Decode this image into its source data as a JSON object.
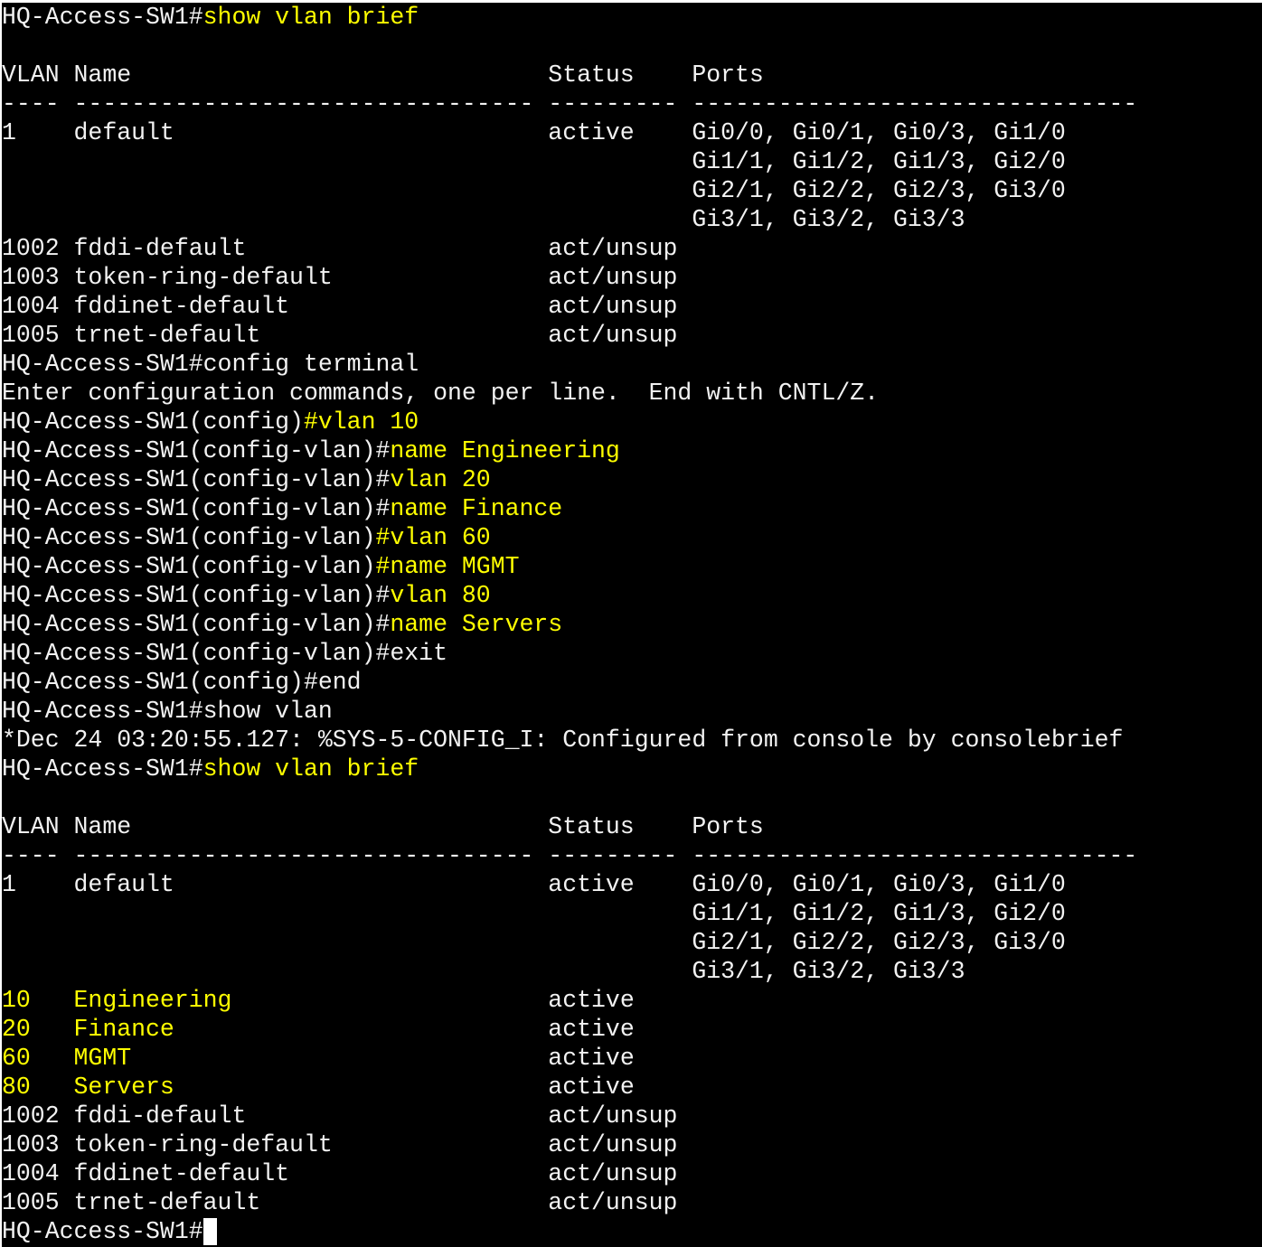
{
  "colors": {
    "background": "#000000",
    "text": "#f2f2f2",
    "highlight": "#ffff00",
    "cursor": "#ffffff"
  },
  "terminal": {
    "lines": [
      [
        {
          "t": "HQ-Access-SW1#"
        },
        {
          "t": "show vlan brief",
          "hl": true
        }
      ],
      [
        {
          "t": ""
        }
      ],
      [
        {
          "t": "VLAN Name                             Status    Ports"
        }
      ],
      [
        {
          "t": "---- -------------------------------- --------- -------------------------------"
        }
      ],
      [
        {
          "t": "1    default                          active    Gi0/0, Gi0/1, Gi0/3, Gi1/0"
        }
      ],
      [
        {
          "t": "                                                Gi1/1, Gi1/2, Gi1/3, Gi2/0"
        }
      ],
      [
        {
          "t": "                                                Gi2/1, Gi2/2, Gi2/3, Gi3/0"
        }
      ],
      [
        {
          "t": "                                                Gi3/1, Gi3/2, Gi3/3"
        }
      ],
      [
        {
          "t": "1002 fddi-default                     act/unsup"
        }
      ],
      [
        {
          "t": "1003 token-ring-default               act/unsup"
        }
      ],
      [
        {
          "t": "1004 fddinet-default                  act/unsup"
        }
      ],
      [
        {
          "t": "1005 trnet-default                    act/unsup"
        }
      ],
      [
        {
          "t": "HQ-Access-SW1#config terminal"
        }
      ],
      [
        {
          "t": "Enter configuration commands, one per line.  End with CNTL/Z."
        }
      ],
      [
        {
          "t": "HQ-Access-SW1(config)"
        },
        {
          "t": "#vlan 10",
          "hl": true
        }
      ],
      [
        {
          "t": "HQ-Access-SW1(config-vlan)#"
        },
        {
          "t": "name Engineering",
          "hl": true
        }
      ],
      [
        {
          "t": "HQ-Access-SW1(config-vlan)#"
        },
        {
          "t": "vlan 20",
          "hl": true
        }
      ],
      [
        {
          "t": "HQ-Access-SW1(config-vlan)#"
        },
        {
          "t": "name Finance",
          "hl": true
        }
      ],
      [
        {
          "t": "HQ-Access-SW1(config-vlan)"
        },
        {
          "t": "#vlan 60",
          "hl": true
        }
      ],
      [
        {
          "t": "HQ-Access-SW1(config-vlan)"
        },
        {
          "t": "#name MGMT",
          "hl": true
        }
      ],
      [
        {
          "t": "HQ-Access-SW1(config-vlan)#"
        },
        {
          "t": "vlan 80",
          "hl": true
        }
      ],
      [
        {
          "t": "HQ-Access-SW1(config-vlan)#"
        },
        {
          "t": "name Servers",
          "hl": true
        }
      ],
      [
        {
          "t": "HQ-Access-SW1(config-vlan)#exit"
        }
      ],
      [
        {
          "t": "HQ-Access-SW1(config)#end"
        }
      ],
      [
        {
          "t": "HQ-Access-SW1#show vlan"
        }
      ],
      [
        {
          "t": "*Dec 24 03:20:55.127: %SYS-5-CONFIG_I: Configured from console by consolebrief"
        }
      ],
      [
        {
          "t": "HQ-Access-SW1#"
        },
        {
          "t": "show vlan brief",
          "hl": true
        }
      ],
      [
        {
          "t": ""
        }
      ],
      [
        {
          "t": "VLAN Name                             Status    Ports"
        }
      ],
      [
        {
          "t": "---- -------------------------------- --------- -------------------------------"
        }
      ],
      [
        {
          "t": "1    default                          active    Gi0/0, Gi0/1, Gi0/3, Gi1/0"
        }
      ],
      [
        {
          "t": "                                                Gi1/1, Gi1/2, Gi1/3, Gi2/0"
        }
      ],
      [
        {
          "t": "                                                Gi2/1, Gi2/2, Gi2/3, Gi3/0"
        }
      ],
      [
        {
          "t": "                                                Gi3/1, Gi3/2, Gi3/3"
        }
      ],
      [
        {
          "t": "10   Engineering",
          "hl": true
        },
        {
          "t": "                      active"
        }
      ],
      [
        {
          "t": "20   Finance",
          "hl": true
        },
        {
          "t": "                          active"
        }
      ],
      [
        {
          "t": "60   MGMT",
          "hl": true
        },
        {
          "t": "                             active"
        }
      ],
      [
        {
          "t": "80   Servers",
          "hl": true
        },
        {
          "t": "                          active"
        }
      ],
      [
        {
          "t": "1002 fddi-default                     act/unsup"
        }
      ],
      [
        {
          "t": "1003 token-ring-default               act/unsup"
        }
      ],
      [
        {
          "t": "1004 fddinet-default                  act/unsup"
        }
      ],
      [
        {
          "t": "1005 trnet-default                    act/unsup"
        }
      ],
      [
        {
          "t": "HQ-Access-SW1#"
        },
        {
          "cursor": true
        }
      ]
    ]
  }
}
